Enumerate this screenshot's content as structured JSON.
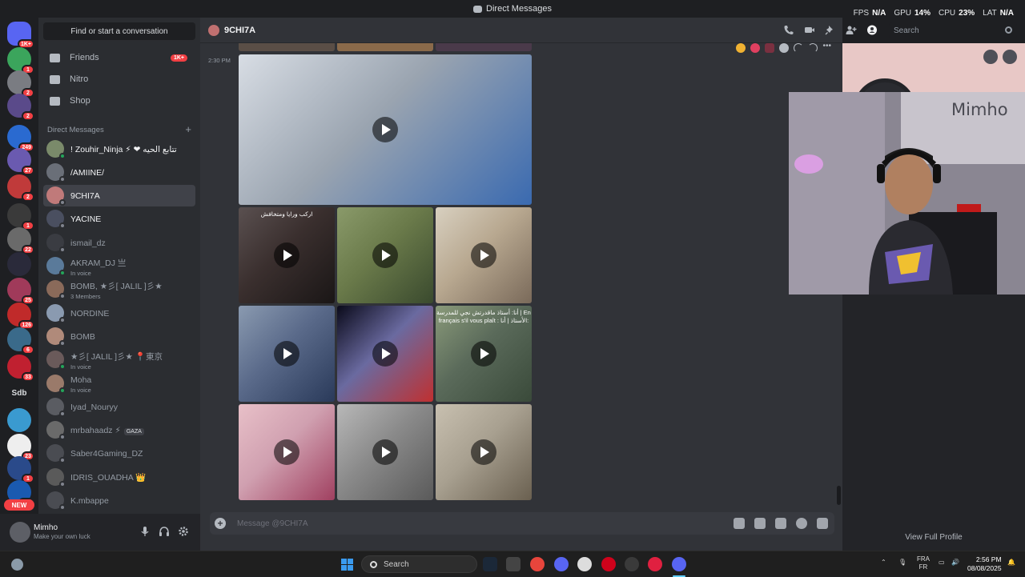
{
  "window": {
    "title": "Direct Messages"
  },
  "overlay": [
    {
      "label": "FPS",
      "value": "N/A"
    },
    {
      "label": "GPU",
      "value": "14%"
    },
    {
      "label": "CPU",
      "value": "23%"
    },
    {
      "label": "LAT",
      "value": "N/A"
    }
  ],
  "servers": {
    "home_badge": "1K+",
    "badges": [
      "1",
      "2",
      "2",
      "249",
      "27",
      "2",
      "1",
      "22",
      "",
      "25",
      "126",
      "6",
      "33",
      "",
      "23",
      "1",
      "270"
    ],
    "text_server": "Sdb",
    "new_label": "NEW"
  },
  "sidebar": {
    "find_label": "Find or start a conversation",
    "nav": [
      {
        "label": "Friends",
        "icon": "friends-icon",
        "badge": "1K+"
      },
      {
        "label": "Nitro",
        "icon": "nitro-icon",
        "badge": ""
      },
      {
        "label": "Shop",
        "icon": "shop-icon",
        "badge": ""
      }
    ],
    "dm_header": "Direct Messages",
    "dms": [
      {
        "name": "! Zouhir_Ninja ⚡ ❤ تتابع الحيه",
        "sub": "",
        "color": "#7a8a6a",
        "online": true,
        "bright": true
      },
      {
        "name": "/AMIINE/",
        "sub": "",
        "color": "#6a6f78",
        "online": false,
        "bright": true
      },
      {
        "name": "9CHI7A",
        "sub": "",
        "color": "#c07a7a",
        "online": false,
        "bright": true,
        "active": true
      },
      {
        "name": "YACINE",
        "sub": "",
        "color": "#4a4f60",
        "online": false,
        "bright": true
      },
      {
        "name": "ismail_dz",
        "sub": "",
        "color": "#3a3c42",
        "online": false,
        "bright": false
      },
      {
        "name": "AKRAM_DJ 亗",
        "sub": "In voice",
        "color": "#5a7a9a",
        "online": true,
        "bright": false
      },
      {
        "name": "BOMB, ★彡[ JALIL ]彡★",
        "sub": "3 Members",
        "color": "#8a6a5a",
        "online": false,
        "bright": false
      },
      {
        "name": "NORDINE",
        "sub": "",
        "color": "#8a9ab0",
        "online": false,
        "bright": false
      },
      {
        "name": "BOMB",
        "sub": "",
        "color": "#b08a7a",
        "online": false,
        "bright": false
      },
      {
        "name": "★彡[ JALIL ]彡★ 📍東京",
        "sub": "In voice",
        "color": "#6a5a5a",
        "online": true,
        "bright": false
      },
      {
        "name": "Moha",
        "sub": "In voice",
        "color": "#9a7a6a",
        "online": true,
        "bright": false
      },
      {
        "name": "Iyad_Nouryy",
        "sub": "",
        "color": "#5a5c62",
        "online": false,
        "bright": false
      },
      {
        "name": "mrbahaadz ⚡",
        "sub": "",
        "color": "#6a6a6a",
        "online": false,
        "bright": false,
        "tag": "GAZA"
      },
      {
        "name": "Saber4Gaming_DZ",
        "sub": "",
        "color": "#4a4c52",
        "online": false,
        "bright": false
      },
      {
        "name": "IDRIS_OUADHA 👑",
        "sub": "",
        "color": "#5a5a5a",
        "online": false,
        "bright": false
      },
      {
        "name": "K.mbappe",
        "sub": "",
        "color": "#4a4c52",
        "online": false,
        "bright": false
      }
    ]
  },
  "user": {
    "name": "Mimho",
    "status": "Make your own luck"
  },
  "chat": {
    "title": "9CHI7A",
    "search_placeholder": "Search",
    "timestamp": "2:30 PM",
    "composer_placeholder": "Message @9CHI7A",
    "media": [
      {
        "caption": "",
        "palette": [
          "#9aa4b0",
          "#3a6ab0",
          "#d8dde4"
        ]
      },
      {
        "caption": "اركب ورايا ومتخافش",
        "palette": [
          "#3a2f2e",
          "#1a1616",
          "#5a5050"
        ]
      },
      {
        "caption": "",
        "palette": [
          "#6a7a4a",
          "#3a4a2e",
          "#8a9a6a"
        ]
      },
      {
        "caption": "",
        "palette": [
          "#b8a890",
          "#7a6a5a",
          "#d8d0c0"
        ]
      },
      {
        "caption": "",
        "palette": [
          "#5a6a8a",
          "#2a3a5a",
          "#8a9ab0"
        ]
      },
      {
        "caption": "",
        "palette": [
          "#6a6aa0",
          "#c03030",
          "#0a0a1a"
        ]
      },
      {
        "caption": "أنا: أستاذ ماقدرتش نجي للمدرسة | En français s'il vous plaît : الأستاذ | أنا:",
        "palette": [
          "#5a6a5a",
          "#3a4a3a",
          "#8a9a7a"
        ]
      },
      {
        "caption": "",
        "palette": [
          "#d0a0b0",
          "#a04060",
          "#e8c0c8"
        ]
      },
      {
        "caption": "",
        "palette": [
          "#8a8a8a",
          "#5a5a5a",
          "#b8b8b8"
        ]
      },
      {
        "caption": "",
        "palette": [
          "#a8a090",
          "#6a6050",
          "#c8c0b0"
        ]
      }
    ]
  },
  "profile": {
    "view_full": "View Full Profile"
  },
  "webcam": {
    "name": "Mimho"
  },
  "taskbar": {
    "search_label": "Search",
    "language": "FRA",
    "language_sub": "FR",
    "time": "2:56 PM",
    "date": "08/08/2025"
  }
}
